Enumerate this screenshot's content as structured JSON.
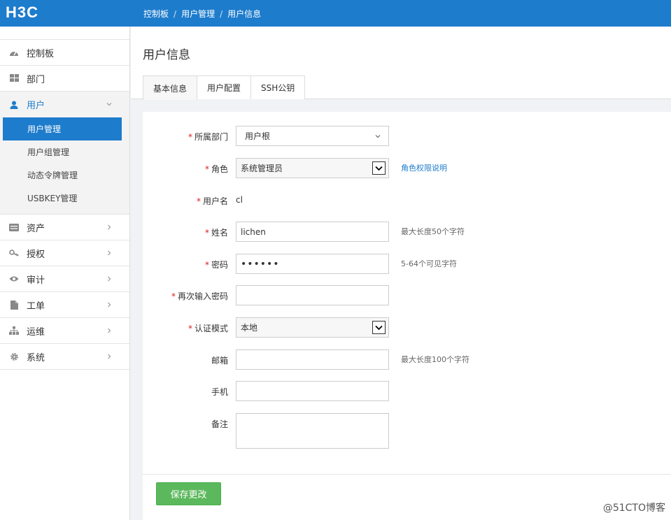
{
  "brand": {
    "logo_text": "H3C"
  },
  "breadcrumb": [
    "控制板",
    "用户管理",
    "用户信息"
  ],
  "sidebar": {
    "items": [
      {
        "label": "控制板",
        "icon": "dashboard-icon"
      },
      {
        "label": "部门",
        "icon": "grid-icon"
      },
      {
        "label": "用户",
        "icon": "user-icon",
        "expanded": true,
        "children": [
          {
            "label": "用户管理",
            "active": true
          },
          {
            "label": "用户组管理"
          },
          {
            "label": "动态令牌管理"
          },
          {
            "label": "USBKEY管理"
          }
        ]
      },
      {
        "label": "资产",
        "icon": "server-icon"
      },
      {
        "label": "授权",
        "icon": "key-icon"
      },
      {
        "label": "审计",
        "icon": "eye-icon"
      },
      {
        "label": "工单",
        "icon": "document-icon"
      },
      {
        "label": "运维",
        "icon": "sitemap-icon"
      },
      {
        "label": "系统",
        "icon": "gear-icon"
      }
    ]
  },
  "page": {
    "title": "用户信息",
    "tabs": [
      "基本信息",
      "用户配置",
      "SSH公钥"
    ],
    "active_tab": 0
  },
  "form": {
    "required_mark": "*",
    "department": {
      "label": "所属部门",
      "value": "用户根"
    },
    "role": {
      "label": "角色",
      "value": "系统管理员",
      "link": "角色权限说明"
    },
    "username": {
      "label": "用户名",
      "value": "cl"
    },
    "name": {
      "label": "姓名",
      "value": "lichen",
      "hint": "最大长度50个字符"
    },
    "password": {
      "label": "密码",
      "value": "••••••",
      "hint": "5-64个可见字符"
    },
    "password_confirm": {
      "label": "再次输入密码",
      "value": ""
    },
    "auth_mode": {
      "label": "认证模式",
      "value": "本地"
    },
    "email": {
      "label": "邮箱",
      "value": "",
      "hint": "最大长度100个字符"
    },
    "phone": {
      "label": "手机",
      "value": ""
    },
    "note": {
      "label": "备注",
      "value": ""
    },
    "save_label": "保存更改"
  },
  "watermark": "@51CTO博客",
  "colors": {
    "primary": "#1e7ccc",
    "success": "#5cb85c",
    "required": "#d9201f"
  }
}
